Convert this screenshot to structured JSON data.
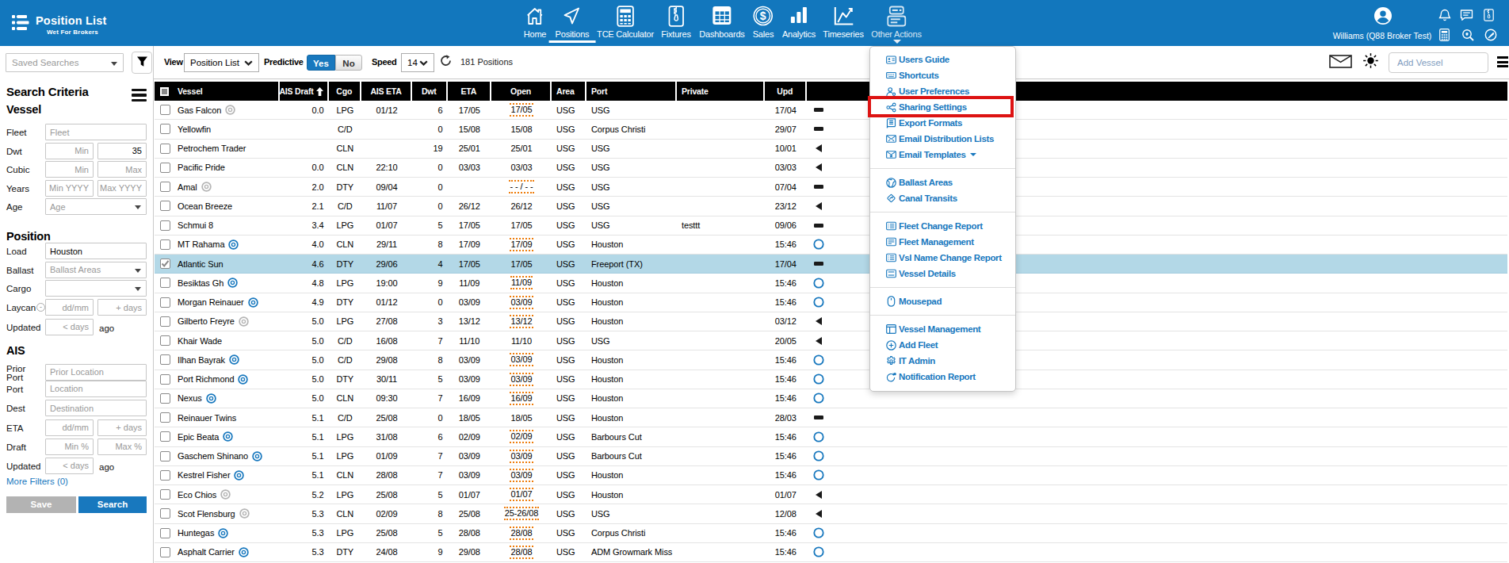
{
  "app": {
    "title": "Position List",
    "subtitle": "Wet For Brokers"
  },
  "header": {
    "nav": [
      {
        "label": "Home",
        "icon": "home"
      },
      {
        "label": "Positions",
        "icon": "positions",
        "active": true
      },
      {
        "label": "TCE Calculator",
        "icon": "tce-calculator"
      },
      {
        "label": "Fixtures",
        "icon": "fixtures"
      },
      {
        "label": "Dashboards",
        "icon": "dashboards"
      },
      {
        "label": "Sales",
        "icon": "sales"
      },
      {
        "label": "Analytics",
        "icon": "analytics"
      },
      {
        "label": "Timeseries",
        "icon": "timeseries"
      },
      {
        "label": "Other Actions",
        "icon": "other-actions",
        "dimmed": true
      }
    ],
    "user": {
      "name": "Williams (Q88 Broker Test)"
    },
    "quick_icons": [
      {
        "icon": "bell"
      },
      {
        "icon": "chat"
      },
      {
        "icon": "fixtures-mini"
      },
      {
        "icon": "calculator-mini"
      },
      {
        "icon": "search-heart"
      },
      {
        "icon": "pen-circle"
      }
    ]
  },
  "sidebar": {
    "saved_searches_placeholder": "Saved Searches",
    "title": "Search Criteria",
    "sections": [
      {
        "heading": "Vessel",
        "fields": [
          {
            "label": "Fleet",
            "inputs": [
              {
                "placeholder": "Fleet",
                "w": "full"
              }
            ]
          },
          {
            "label": "Dwt",
            "inputs": [
              {
                "placeholder": "Min",
                "align": "r"
              },
              {
                "value": "35",
                "align": "r"
              }
            ]
          },
          {
            "label": "Cubic",
            "inputs": [
              {
                "placeholder": "Min",
                "align": "r"
              },
              {
                "placeholder": "Max",
                "align": "r"
              }
            ]
          },
          {
            "label": "Years",
            "inputs": [
              {
                "placeholder": "Min YYYY",
                "align": "r"
              },
              {
                "placeholder": "Max YYYY",
                "align": "r"
              }
            ]
          },
          {
            "label": "Age",
            "inputs": [
              {
                "placeholder": "Age",
                "w": "full",
                "select": true
              }
            ]
          }
        ]
      },
      {
        "heading": "Position",
        "fields": [
          {
            "label": "Load",
            "inputs": [
              {
                "value": "Houston",
                "w": "full"
              }
            ]
          },
          {
            "label": "Ballast",
            "inputs": [
              {
                "placeholder": "Ballast Areas",
                "w": "full",
                "select": true
              }
            ]
          },
          {
            "label": "Cargo",
            "inputs": [
              {
                "placeholder": "",
                "w": "full",
                "select": true
              }
            ]
          },
          {
            "label": "Laycan",
            "minus": true,
            "inputs": [
              {
                "placeholder": "dd/mm",
                "align": "r"
              },
              {
                "placeholder": "+ days",
                "align": "r"
              }
            ]
          },
          {
            "label": "Updated",
            "inputs": [
              {
                "placeholder": "< days",
                "align": "r"
              }
            ],
            "suffix": "ago"
          }
        ]
      },
      {
        "heading": "AIS",
        "fields": [
          {
            "label": "Prior\nPort",
            "inputs": [
              {
                "placeholder": "Prior Location",
                "w": "full"
              }
            ]
          },
          {
            "label": "Port",
            "inputs": [
              {
                "placeholder": "Location",
                "w": "full"
              }
            ]
          },
          {
            "label": "Dest",
            "inputs": [
              {
                "placeholder": "Destination",
                "w": "full"
              }
            ]
          },
          {
            "label": "ETA",
            "inputs": [
              {
                "placeholder": "dd/mm",
                "align": "r"
              },
              {
                "placeholder": "+ days",
                "align": "r"
              }
            ]
          },
          {
            "label": "Draft",
            "inputs": [
              {
                "placeholder": "Min %",
                "align": "r"
              },
              {
                "placeholder": "Max %",
                "align": "r"
              }
            ]
          },
          {
            "label": "Updated",
            "inputs": [
              {
                "placeholder": "< days",
                "align": "r"
              }
            ],
            "suffix": "ago"
          }
        ]
      }
    ],
    "more_filters": "More Filters (0)",
    "save_label": "Save",
    "search_label": "Search"
  },
  "toolbar": {
    "view_label": "View",
    "view_value": "Position List",
    "predictive_label": "Predictive",
    "yes_label": "Yes",
    "no_label": "No",
    "speed_label": "Speed",
    "speed_value": "14",
    "positions_count": "181 Positions",
    "add_vessel_placeholder": "Add Vessel"
  },
  "table": {
    "columns": [
      {
        "label": "Vessel",
        "align": "l"
      },
      {
        "label": "AIS Draft",
        "align": "r",
        "sorted": true
      },
      {
        "label": "Cgo",
        "align": "c"
      },
      {
        "label": "AIS ETA",
        "align": "c"
      },
      {
        "label": "Dwt",
        "align": "c"
      },
      {
        "label": "ETA",
        "align": "c"
      },
      {
        "label": "Open",
        "align": "c"
      },
      {
        "label": "Area",
        "align": "l"
      },
      {
        "label": "Port",
        "align": "l"
      },
      {
        "label": "Private",
        "align": "l"
      },
      {
        "label": "Upd",
        "align": "c"
      },
      {
        "label": "",
        "align": "l"
      }
    ],
    "rows": [
      {
        "vessel": "Gas Falcon",
        "target": "gray",
        "ais_draft": "0.0",
        "cgo": "LPG",
        "ais_eta": "01/12",
        "dwt": "6",
        "eta": "17/05",
        "open": "17/05",
        "pred": true,
        "area": "USG",
        "port": "USG",
        "private": "",
        "upd": "17/04",
        "status": "dash"
      },
      {
        "vessel": "Yellowfin",
        "target": "",
        "ais_draft": "",
        "cgo": "C/D",
        "ais_eta": "",
        "dwt": "0",
        "eta": "15/08",
        "open": "15/08",
        "pred": false,
        "area": "USG",
        "port": "Corpus Christi",
        "private": "",
        "upd": "29/07",
        "status": "dash"
      },
      {
        "vessel": "Petrochem Trader",
        "target": "",
        "ais_draft": "",
        "cgo": "CLN",
        "ais_eta": "",
        "dwt": "19",
        "eta": "25/01",
        "open": "25/01",
        "pred": false,
        "area": "USG",
        "port": "USG",
        "private": "",
        "upd": "10/01",
        "status": "back"
      },
      {
        "vessel": "Pacific Pride",
        "target": "",
        "ais_draft": "0.0",
        "cgo": "CLN",
        "ais_eta": "22:10",
        "dwt": "0",
        "eta": "03/03",
        "open": "03/03",
        "pred": false,
        "area": "USG",
        "port": "USG",
        "private": "",
        "upd": "03/03",
        "status": "back"
      },
      {
        "vessel": "Amal",
        "target": "gray",
        "ais_draft": "2.0",
        "cgo": "DTY",
        "ais_eta": "09/04",
        "dwt": "0",
        "eta": "",
        "open": "- - / - -",
        "pred": true,
        "area": "USG",
        "port": "USG",
        "private": "",
        "upd": "07/04",
        "status": "dash"
      },
      {
        "vessel": "Ocean Breeze",
        "target": "",
        "ais_draft": "2.1",
        "cgo": "C/D",
        "ais_eta": "11/07",
        "dwt": "0",
        "eta": "26/12",
        "open": "26/12",
        "pred": false,
        "area": "USG",
        "port": "USG",
        "private": "",
        "upd": "23/12",
        "status": "back"
      },
      {
        "vessel": "Schmui 8",
        "target": "",
        "ais_draft": "3.4",
        "cgo": "LPG",
        "ais_eta": "01/07",
        "dwt": "5",
        "eta": "17/05",
        "open": "17/05",
        "pred": false,
        "area": "USG",
        "port": "USG",
        "private": "testtt",
        "upd": "09/06",
        "status": "dash"
      },
      {
        "vessel": "MT Rahama",
        "target": "blue",
        "ais_draft": "4.0",
        "cgo": "CLN",
        "ais_eta": "29/11",
        "dwt": "8",
        "eta": "17/09",
        "open": "17/09",
        "pred": true,
        "area": "USG",
        "port": "Houston",
        "private": "",
        "upd": "15:46",
        "status": "circle"
      },
      {
        "vessel": "Atlantic Sun",
        "target": "",
        "selected": true,
        "checked": true,
        "ais_draft": "4.6",
        "cgo": "DTY",
        "ais_eta": "29/06",
        "dwt": "4",
        "eta": "17/05",
        "open": "17/05",
        "pred": false,
        "area": "USG",
        "port": "Freeport (TX)",
        "private": "",
        "upd": "17/04",
        "status": "dash"
      },
      {
        "vessel": "Besiktas Gh",
        "target": "blue",
        "ais_draft": "4.8",
        "cgo": "LPG",
        "ais_eta": "19:00",
        "dwt": "9",
        "eta": "11/09",
        "open": "11/09",
        "pred": true,
        "area": "USG",
        "port": "Houston",
        "private": "",
        "upd": "15:46",
        "status": "circle"
      },
      {
        "vessel": "Morgan Reinauer",
        "target": "blue",
        "ais_draft": "4.9",
        "cgo": "DTY",
        "ais_eta": "01/12",
        "dwt": "0",
        "eta": "03/09",
        "open": "03/09",
        "pred": true,
        "area": "USG",
        "port": "Houston",
        "private": "",
        "upd": "15:46",
        "status": "circle"
      },
      {
        "vessel": "Gilberto Freyre",
        "target": "gray",
        "ais_draft": "5.0",
        "cgo": "LPG",
        "ais_eta": "27/08",
        "dwt": "3",
        "eta": "13/12",
        "open": "13/12",
        "pred": true,
        "area": "USG",
        "port": "Houston",
        "private": "",
        "upd": "03/12",
        "status": "back"
      },
      {
        "vessel": "Khair Wade",
        "target": "",
        "ais_draft": "5.0",
        "cgo": "C/D",
        "ais_eta": "16/08",
        "dwt": "7",
        "eta": "11/10",
        "open": "11/10",
        "pred": false,
        "area": "USG",
        "port": "USG",
        "private": "",
        "upd": "20/05",
        "status": "back"
      },
      {
        "vessel": "Ilhan Bayrak",
        "target": "blue",
        "ais_draft": "5.0",
        "cgo": "C/D",
        "ais_eta": "29/08",
        "dwt": "8",
        "eta": "03/09",
        "open": "03/09",
        "pred": true,
        "area": "USG",
        "port": "Houston",
        "private": "",
        "upd": "15:46",
        "status": "circle"
      },
      {
        "vessel": "Port Richmond",
        "target": "blue",
        "ais_draft": "5.0",
        "cgo": "DTY",
        "ais_eta": "30/11",
        "dwt": "5",
        "eta": "03/09",
        "open": "03/09",
        "pred": true,
        "area": "USG",
        "port": "Houston",
        "private": "",
        "upd": "15:46",
        "status": "circle"
      },
      {
        "vessel": "Nexus",
        "target": "blue",
        "ais_draft": "5.0",
        "cgo": "CLN",
        "ais_eta": "09:30",
        "dwt": "7",
        "eta": "16/09",
        "open": "16/09",
        "pred": true,
        "area": "USG",
        "port": "Houston",
        "private": "",
        "upd": "15:46",
        "status": "circle"
      },
      {
        "vessel": "Reinauer Twins",
        "target": "",
        "ais_draft": "5.1",
        "cgo": "C/D",
        "ais_eta": "25/08",
        "dwt": "0",
        "eta": "18/05",
        "open": "18/05",
        "pred": false,
        "area": "USG",
        "port": "Houston",
        "private": "",
        "upd": "28/03",
        "status": "dash"
      },
      {
        "vessel": "Epic Beata",
        "target": "blue",
        "ais_draft": "5.1",
        "cgo": "LPG",
        "ais_eta": "31/08",
        "dwt": "6",
        "eta": "02/09",
        "open": "02/09",
        "pred": true,
        "area": "USG",
        "port": "Barbours Cut",
        "private": "",
        "upd": "15:46",
        "status": "circle"
      },
      {
        "vessel": "Gaschem Shinano",
        "target": "blue",
        "ais_draft": "5.1",
        "cgo": "LPG",
        "ais_eta": "01/09",
        "dwt": "7",
        "eta": "03/09",
        "open": "03/09",
        "pred": true,
        "area": "USG",
        "port": "Barbours Cut",
        "private": "",
        "upd": "15:46",
        "status": "circle"
      },
      {
        "vessel": "Kestrel Fisher",
        "target": "blue",
        "ais_draft": "5.1",
        "cgo": "CLN",
        "ais_eta": "28/08",
        "dwt": "7",
        "eta": "03/09",
        "open": "03/09",
        "pred": true,
        "area": "USG",
        "port": "Houston",
        "private": "",
        "upd": "15:46",
        "status": "circle"
      },
      {
        "vessel": "Eco Chios",
        "target": "gray",
        "ais_draft": "5.2",
        "cgo": "LPG",
        "ais_eta": "25/08",
        "dwt": "5",
        "eta": "01/07",
        "open": "01/07",
        "pred": true,
        "area": "USG",
        "port": "Houston",
        "private": "",
        "upd": "01/07",
        "status": "back"
      },
      {
        "vessel": "Scot Flensburg",
        "target": "gray",
        "ais_draft": "5.3",
        "cgo": "CLN",
        "ais_eta": "02/09",
        "dwt": "8",
        "eta": "25/08",
        "open": "25-26/08",
        "pred": true,
        "area": "USG",
        "port": "USG",
        "private": "",
        "upd": "12/08",
        "status": "back"
      },
      {
        "vessel": "Huntegas",
        "target": "blue",
        "ais_draft": "5.3",
        "cgo": "LPG",
        "ais_eta": "25/08",
        "dwt": "5",
        "eta": "28/08",
        "open": "28/08",
        "pred": true,
        "area": "USG",
        "port": "Corpus Christi",
        "private": "",
        "upd": "15:46",
        "status": "circle"
      },
      {
        "vessel": "Asphalt Carrier",
        "target": "blue",
        "ais_draft": "5.3",
        "cgo": "DTY",
        "ais_eta": "24/08",
        "dwt": "9",
        "eta": "29/08",
        "open": "28/08",
        "pred": true,
        "area": "USG",
        "port": "ADM Growmark Miss",
        "private": "",
        "upd": "15:46",
        "status": "circle"
      }
    ]
  },
  "actions_menu": {
    "sections": [
      {
        "items": [
          {
            "label": "Users Guide",
            "icon": "address-card"
          },
          {
            "label": "Shortcuts",
            "icon": "keyboard"
          },
          {
            "label": "User Preferences",
            "icon": "user-gear"
          },
          {
            "label": "Sharing Settings",
            "icon": "share",
            "highlighted": true
          },
          {
            "label": "Export Formats",
            "icon": "file-lines"
          },
          {
            "label": "Email Distribution Lists",
            "icon": "envelope-arrows"
          },
          {
            "label": "Email Templates",
            "icon": "envelope-star",
            "caret": true
          }
        ]
      },
      {
        "items": [
          {
            "label": "Ballast Areas",
            "icon": "globe"
          },
          {
            "label": "Canal Transits",
            "icon": "diamond-transit"
          }
        ]
      },
      {
        "items": [
          {
            "label": "Fleet Change Report",
            "icon": "list-card"
          },
          {
            "label": "Fleet Management",
            "icon": "text-card"
          },
          {
            "label": "Vsl Name Change Report",
            "icon": "list-card"
          },
          {
            "label": "Vessel Details",
            "icon": "panel-card"
          }
        ]
      },
      {
        "items": [
          {
            "label": "Mousepad",
            "icon": "mouse"
          }
        ]
      },
      {
        "items": [
          {
            "label": "Vessel Management",
            "icon": "window-split"
          },
          {
            "label": "Add Fleet",
            "icon": "plus-circle"
          },
          {
            "label": "IT Admin",
            "icon": "gear"
          },
          {
            "label": "Notification Report",
            "icon": "notification"
          }
        ]
      }
    ]
  },
  "colors": {
    "header_blue": "#1277bd",
    "brand_blue": "#1878be",
    "selected_row": "#b3d8e7",
    "predictive_orange": "#ee7d0c",
    "highlight_red": "#dd1312"
  }
}
